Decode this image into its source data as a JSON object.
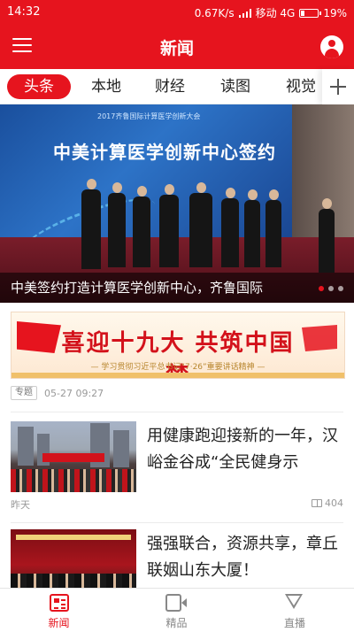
{
  "status_bar": {
    "time": "14:32",
    "network_speed": "0.67K/s",
    "carrier": "移动 4G",
    "battery": "19%"
  },
  "nav": {
    "title": "新闻",
    "menu_icon": "hamburger-menu-icon",
    "profile_icon": "user-avatar-icon"
  },
  "tabs": [
    {
      "label": "头条",
      "active": true
    },
    {
      "label": "本地",
      "active": false
    },
    {
      "label": "财经",
      "active": false
    },
    {
      "label": "读图",
      "active": false
    },
    {
      "label": "视觉",
      "active": false
    }
  ],
  "hero": {
    "screen_title": "中美计算医学创新中心签约",
    "conference_title": "2017齐鲁国际计算医学创新大会",
    "caption": "中美签约打造计算医学创新中心，齐鲁国际",
    "slide_count": 3,
    "active_slide": 1
  },
  "banner_article": {
    "slogan": "喜迎十九大  共筑中国梦",
    "subtitle": "— 学习贯彻习近平总书记“7·26”重要讲话精神 —",
    "tag": "专题",
    "date": "05-27 09:27"
  },
  "articles": [
    {
      "headline": "用健康跑迎接新的一年，汉峪金谷成“全民健身示",
      "source": "昨天",
      "reads": "404"
    },
    {
      "headline": "强强联合，资源共享，章丘联姻山东大厦！",
      "source": "",
      "reads": ""
    }
  ],
  "bottom_tabs": [
    {
      "label": "新闻",
      "icon": "newspaper-icon",
      "active": true
    },
    {
      "label": "精品",
      "icon": "video-camera-icon",
      "active": false
    },
    {
      "label": "直播",
      "icon": "diamond-icon",
      "active": false
    }
  ],
  "colors": {
    "brand_red": "#e6141e",
    "inactive_gray": "#888888"
  }
}
